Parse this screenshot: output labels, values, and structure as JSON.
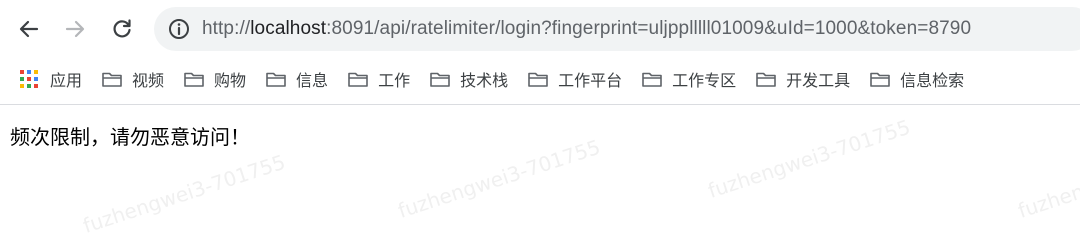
{
  "toolbar": {
    "url": {
      "scheme": "http://",
      "host": "localhost",
      "rest": ":8091/api/ratelimiter/login?fingerprint=uljpplllll01009&uId=1000&token=8790"
    },
    "icons": {
      "back": "back-arrow-icon",
      "forward": "forward-arrow-icon",
      "reload": "reload-icon",
      "info": "info-icon"
    }
  },
  "bookmarks": {
    "items": [
      {
        "label": "应用",
        "icon": "apps-grid-icon"
      },
      {
        "label": "视频",
        "icon": "folder-icon"
      },
      {
        "label": "购物",
        "icon": "folder-icon"
      },
      {
        "label": "信息",
        "icon": "folder-icon"
      },
      {
        "label": "工作",
        "icon": "folder-icon"
      },
      {
        "label": "技术栈",
        "icon": "folder-icon"
      },
      {
        "label": "工作平台",
        "icon": "folder-icon"
      },
      {
        "label": "工作专区",
        "icon": "folder-icon"
      },
      {
        "label": "开发工具",
        "icon": "folder-icon"
      },
      {
        "label": "信息检索",
        "icon": "folder-icon"
      }
    ]
  },
  "page": {
    "message": "频次限制，请勿恶意访问！"
  },
  "watermark": {
    "text": "fuzhengwei3-701755"
  },
  "colors": {
    "omnibox_bg": "#f1f3f4",
    "text_primary": "#202124",
    "text_secondary": "#5f6368",
    "divider": "#dadce0"
  }
}
